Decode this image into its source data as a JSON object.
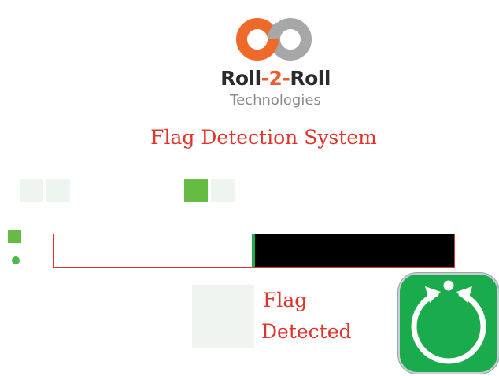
{
  "header": {
    "brand_name_part1": "Roll",
    "brand_name_part2": "-2-",
    "brand_name_part3": "Roll",
    "brand_subtitle": "Technologies",
    "logo_colors": {
      "left_ring": "#ef6a2a",
      "right_ring": "#a7a7a7"
    }
  },
  "system": {
    "title": "Flag Detection System"
  },
  "status_squares": [
    {
      "active": false
    },
    {
      "active": false
    },
    {
      "active": true
    },
    {
      "active": false
    }
  ],
  "indicators": {
    "square_color": "#66bb44",
    "dot_color": "#4cb848"
  },
  "progress": {
    "position_fraction": 0.495,
    "track_border_color": "#e0342b",
    "fill_color": "#000000",
    "marker_color": "#1faa49"
  },
  "detection": {
    "line1": "Flag",
    "line2": "Detected"
  },
  "reset": {
    "icon": "circular-reset-icon",
    "color": "#1aab4c"
  }
}
